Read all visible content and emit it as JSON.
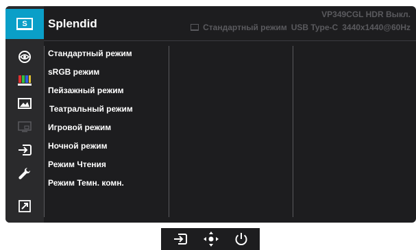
{
  "header": {
    "title": "Splendid",
    "model": "VP349CGL HDR Выкл.",
    "status_mode": "Стандартный режим",
    "status_input": "USB Type-C",
    "status_resolution": "3440x1440@60Hz"
  },
  "sidebar": {
    "items": [
      {
        "icon": "splendid-icon",
        "label": "S",
        "active": true
      },
      {
        "icon": "eye-icon"
      },
      {
        "icon": "color-bars-icon"
      },
      {
        "icon": "image-icon"
      },
      {
        "icon": "pip-icon"
      },
      {
        "icon": "input-select-icon"
      },
      {
        "icon": "wrench-icon"
      },
      {
        "icon": "shortcut-icon"
      }
    ]
  },
  "menu": {
    "items": [
      "Стандартный режим",
      "sRGB режим",
      "Пейзажный режим",
      "Театральный режим",
      "Игровой режим",
      "Ночной режим",
      "Режим Чтения",
      "Режим Темн. комн."
    ]
  },
  "nav": {
    "buttons": [
      "input-icon",
      "joystick-icon",
      "power-icon"
    ]
  },
  "colors": {
    "accent": "#0a9fc8",
    "background": "#1d1d1f",
    "sidebar": "#2a2a2c",
    "text": "#ffffff",
    "muted": "#5a5a5e"
  }
}
